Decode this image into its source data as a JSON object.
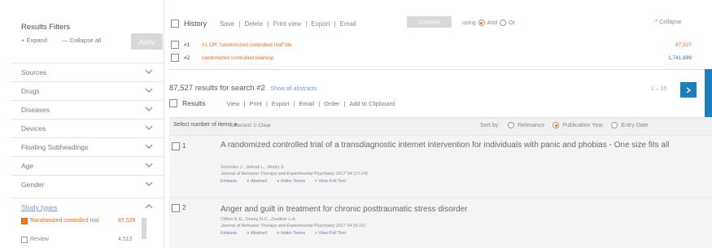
{
  "sidebar": {
    "title": "Results Filters",
    "expand_all": "+ Expand",
    "collapse_all": "— Collapse all",
    "apply_button": "Apply",
    "facets": [
      {
        "label": "Sources"
      },
      {
        "label": "Drugs"
      },
      {
        "label": "Diseases"
      },
      {
        "label": "Devices"
      },
      {
        "label": "Floating Subheadings"
      },
      {
        "label": "Age"
      },
      {
        "label": "Gender"
      },
      {
        "label": "Study types"
      }
    ],
    "study_type_options": [
      {
        "label": "Randomized controlled trial",
        "count": "87,528",
        "checked": true
      },
      {
        "label": "Review",
        "count": "4,513",
        "checked": false
      }
    ]
  },
  "history": {
    "title": "History",
    "toolbar_items": [
      "Save",
      "Delete",
      "Print view",
      "Export",
      "Email"
    ],
    "combine_button": "Combine",
    "using_label": "using",
    "and_label": "And",
    "or_label": "Or",
    "collapse_link": "^ Collapse",
    "rows": [
      {
        "num": "#1",
        "query": "#1 OR \"randomized controlled trial\"/de",
        "count": "87,527"
      },
      {
        "num": "#2",
        "query": "randomized controlled trial/exp",
        "count": "1,741,899"
      }
    ]
  },
  "results": {
    "header": "87,527 results for search #2",
    "show_all_abstracts": "Show all abstracts",
    "toolbar_label": "Results",
    "toolbar_items": [
      "View",
      "Print",
      "Export",
      "Email",
      "Order",
      "Add to Clipboard"
    ],
    "paging": "1 – 25",
    "select_dropdown": "Select number of items",
    "selected_text": "Selected: 0 Clear",
    "sort_label": "Sort by:",
    "sort_options": [
      "Relevance",
      "Publication Year",
      "Entry Date"
    ],
    "sort_selected": "Publication Year",
    "items": [
      {
        "index": "1",
        "title": "A randomized controlled trial of a transdiagnostic internet intervention for individuals with panic and phobias - One size fits all",
        "authors": "Schröder J., Jelinek L., Moritz S.",
        "journal": "Journal of Behavior Therapy and Experimental Psychiatry 2017 54 (17-24)",
        "links": [
          "Embase",
          "∨ Abstract",
          "∨ Index Terms",
          "> View Full Text"
        ]
      },
      {
        "index": "2",
        "title": "Anger and guilt in treatment for chronic posttraumatic stress disorder",
        "authors": "Clifton E.G., Feeny N.C., Zoellner L.A.",
        "journal": "Journal of Behavior Therapy and Experimental Psychiatry 2017 54 (9-16)",
        "links": [
          "Embase",
          "∨ Abstract",
          "∨ Index Terms",
          "> View Full Text"
        ]
      }
    ]
  },
  "colors": {
    "accent": "#1f7fb8",
    "query_orange": "#e07020",
    "checkbox_orange": "#e87a2a",
    "link_blue": "#6a7fb0"
  }
}
